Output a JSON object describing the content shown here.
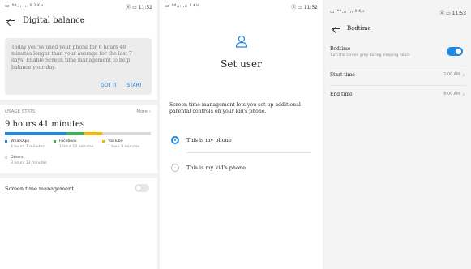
{
  "screen1": {
    "status": {
      "signal": "▭ ᴴᵈ.ᵢₗ .ᵢₗ",
      "speed": "0.2\nK/s",
      "battery_time": "ⓓ ▭ 11:52"
    },
    "title": "Digital balance",
    "notice": {
      "message": "Today you've used your phone for 6 hours 48 minutes longer than your average for the last 7 days. Enable Screen time management to help balance your day.",
      "got_it_label": "GOT IT",
      "start_label": "START"
    },
    "usage": {
      "header": "USAGE STATS",
      "more_label": "More",
      "total": "9 hours 41 minutes",
      "apps": [
        {
          "name": "WhatsApp",
          "duration": "4 hours 3 minutes",
          "color": "#1e88e5",
          "minutes": 243
        },
        {
          "name": "Facebook",
          "duration": "1 hour 13 minutes",
          "color": "#43b05c",
          "minutes": 73
        },
        {
          "name": "YouTube",
          "duration": "1 hour 9 minutes",
          "color": "#f5b800",
          "minutes": 69
        },
        {
          "name": "Others",
          "duration": "3 hours 13 minutes",
          "color": "#d9d9d9",
          "minutes": 193
        }
      ]
    },
    "screen_time_label": "Screen time management",
    "screen_time_enabled": false
  },
  "screen2": {
    "status": {
      "signal": "▭ ᴴᵈ.ᵢₗ .ᵢₗ",
      "speed": "0\nK/s",
      "battery_time": "ⓓ ▭ 11:52"
    },
    "title": "Set user",
    "description": "Screen time management lets you set up additional parental controls on your kid's phone.",
    "options": [
      {
        "label": "This is my phone",
        "selected": true
      },
      {
        "label": "This is my kid's phone",
        "selected": false
      }
    ]
  },
  "screen3": {
    "status": {
      "signal": "▭ ᴴᵈ.ᵢₗ .ᵢₗ",
      "speed": "0\nK/s",
      "battery_time": "ⓓ ▭ 11:53"
    },
    "title": "Bedtime",
    "bedtime": {
      "label": "Bedtime",
      "subtitle": "Turn the screen grey during sleeping hours",
      "enabled": true
    },
    "start": {
      "label": "Start time",
      "value": "2:00 AM"
    },
    "end": {
      "label": "End time",
      "value": "8:00 AM"
    }
  }
}
